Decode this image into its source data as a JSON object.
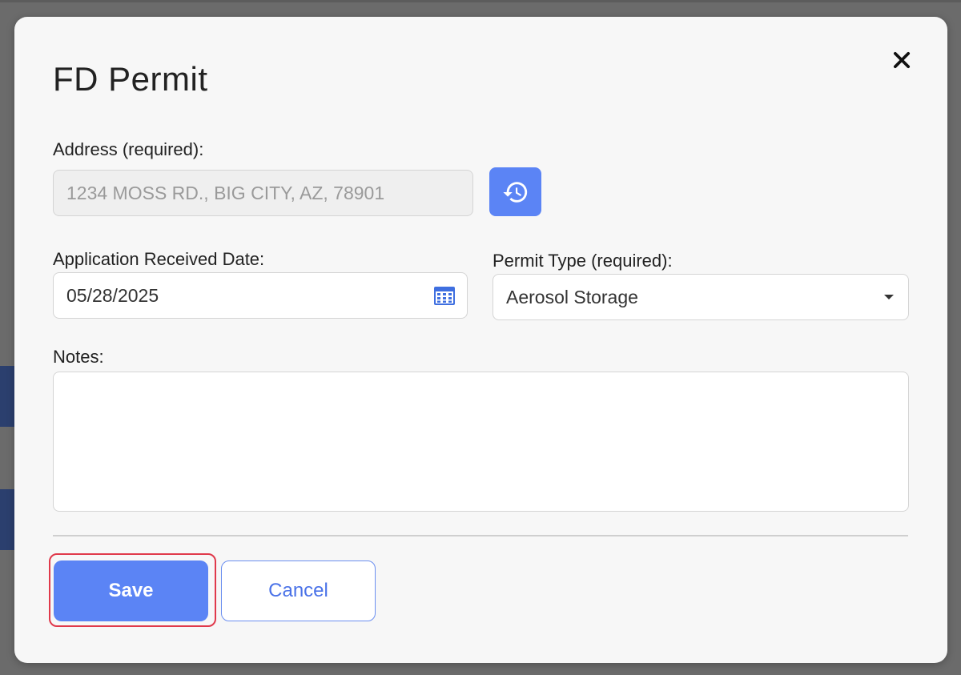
{
  "dialog": {
    "title": "FD Permit",
    "close_icon": "close-icon"
  },
  "address": {
    "label": "Address (required):",
    "value": "1234 MOSS RD., BIG CITY, AZ, 78901",
    "history_icon": "history-icon"
  },
  "received_date": {
    "label": "Application Received Date:",
    "value": "05/28/2025",
    "calendar_icon": "calendar-icon"
  },
  "permit_type": {
    "label": "Permit Type (required):",
    "value": "Aerosol Storage"
  },
  "notes": {
    "label": "Notes:",
    "value": ""
  },
  "actions": {
    "save_label": "Save",
    "cancel_label": "Cancel"
  },
  "colors": {
    "primary": "#5b84f5",
    "highlight": "#e0394b"
  }
}
